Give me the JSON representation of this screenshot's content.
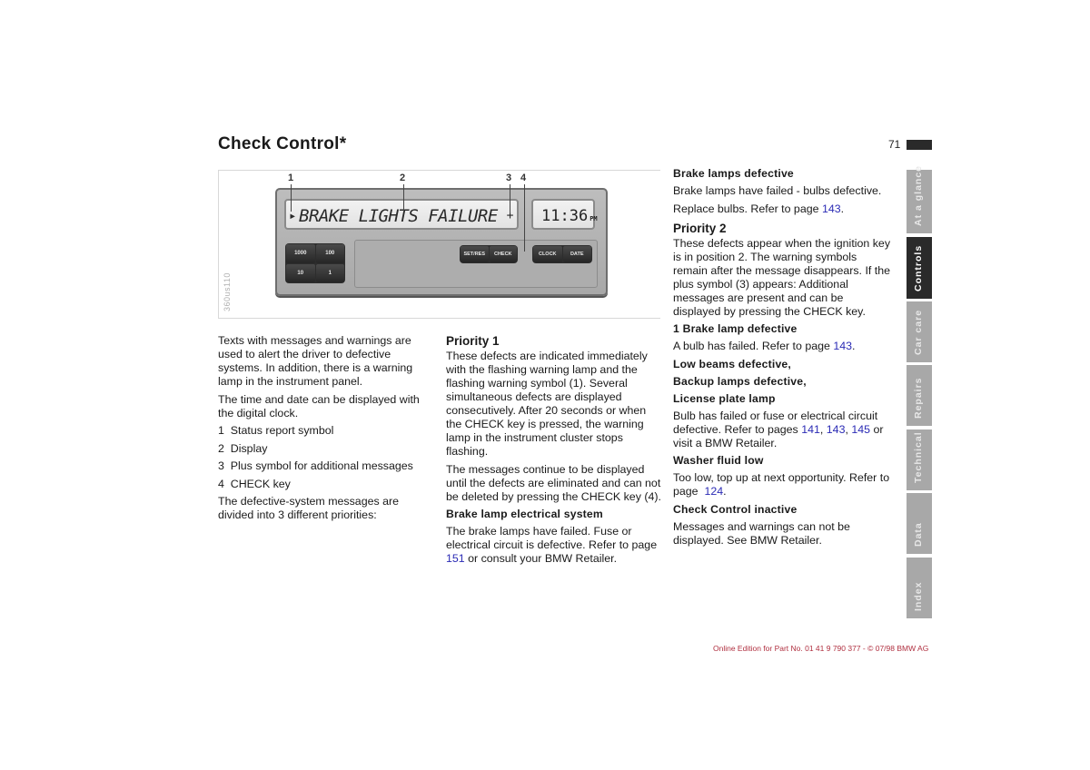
{
  "header": {
    "title": "Check Control*",
    "page_number": "71"
  },
  "figure": {
    "code": "360us110",
    "callouts": [
      "1",
      "2",
      "3",
      "4"
    ],
    "display_text": "BRAKE LIGHTS FAILURE",
    "status_symbol": "▸",
    "plus_symbol": "+",
    "clock_time": "11:36",
    "clock_ampm": "PM",
    "keypad": [
      "1000",
      "100",
      "10",
      "1"
    ],
    "keys_left": [
      "SET/RES",
      "CHECK"
    ],
    "keys_right": [
      "CLOCK",
      "DATE"
    ]
  },
  "col1": {
    "intro": "Texts with messages and warnings are used to alert the driver to defective systems. In addition, there is a warning lamp in the instrument panel.",
    "clock_note": "The time and date can be displayed with the digital clock.",
    "legend": [
      "1  Status report symbol",
      "2  Display",
      "3  Plus symbol for additional messages",
      "4  CHECK key"
    ],
    "priorities_note": "The defective-system messages are divided into 3 different priorities:"
  },
  "col2": {
    "priority1_heading": "Priority 1",
    "priority1_text": "These defects are indicated immediately with the flashing warning lamp and the flashing warning symbol (1). Several simultaneous defects are displayed consecutively. After 20 seconds or when the CHECK key is pressed, the warning lamp in the instrument cluster stops flashing.",
    "priority1_text2": "The messages continue to be displayed until the defects are eliminated and can not be deleted by pressing the CHECK key (4).",
    "brake_elec_heading": "Brake lamp electrical system",
    "brake_elec_text": "The brake lamps have failed. Fuse or electrical circuit is defective. Refer to page",
    "brake_elec_link": "151",
    "brake_elec_tail": " or consult your BMW Retailer."
  },
  "col3": {
    "brake_def_heading": "Brake lamps defective",
    "brake_def_text": "Brake lamps have failed - bulbs defective.",
    "replace_text": "Replace bulbs. Refer to page ",
    "replace_link": "143",
    "priority2_heading": "Priority 2",
    "priority2_text": "These defects appear when the ignition key is in position 2. The warning symbols remain after the message disappears. If the plus symbol (3) appears: Additional messages are present and can be displayed by pressing the CHECK key.",
    "one_brake_heading": "1 Brake lamp defective",
    "one_brake_text": "A bulb has failed. Refer to page ",
    "one_brake_link": "143",
    "low_beams_heading": "Low beams defective,",
    "backup_heading": "Backup lamps defective,",
    "license_heading": "License plate lamp",
    "bulb_text": "Bulb has failed or fuse or electrical circuit defective. Refer to pages ",
    "bulb_links": [
      "141",
      "143",
      "145"
    ],
    "bulb_tail": " or visit a BMW Retailer.",
    "washer_heading": "Washer fluid low",
    "washer_text": "Too low, top up at next opportunity. Refer to page  ",
    "washer_link": "124",
    "inactive_heading": "Check Control inactive",
    "inactive_text": "Messages and warnings can not be displayed. See BMW Retailer."
  },
  "side_tabs": [
    {
      "label": "At a glance",
      "active": false
    },
    {
      "label": "Controls",
      "active": true
    },
    {
      "label": "Car care",
      "active": false
    },
    {
      "label": "Repairs",
      "active": false
    },
    {
      "label": "Technical",
      "active": false
    },
    {
      "label": "Data",
      "active": false
    },
    {
      "label": "Index",
      "active": false
    }
  ],
  "footer": {
    "text": "Online Edition for Part No. 01 41 9 790 377 - © 07/98 BMW AG"
  },
  "colors": {
    "link": "#2b2bb5",
    "footer": "#b03040",
    "tab_active": "#2a2a2a",
    "tab_inactive": "#a8a8a8"
  }
}
